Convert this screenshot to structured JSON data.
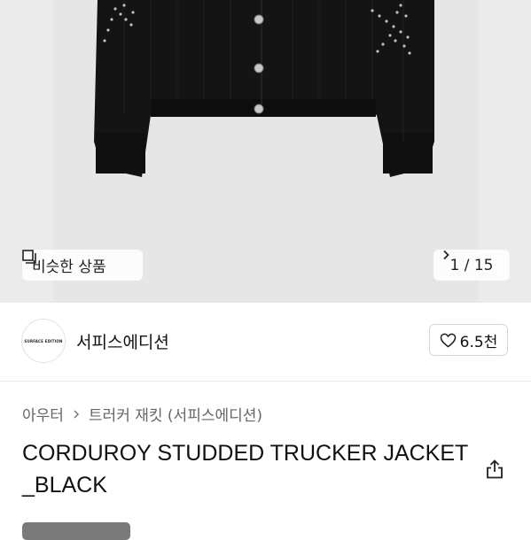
{
  "hero": {
    "image_alt": "black corduroy studded trucker jacket",
    "similar_label": "비슷한 상품",
    "image_counter": "1 / 15"
  },
  "brand": {
    "logo_text": "SURFACE EDITION",
    "name": "서피스에디션",
    "like_count": "6.5천"
  },
  "breadcrumb": {
    "category": "아우터",
    "subcategory": "트러커 재킷 (서피스에디션)"
  },
  "product": {
    "title": "CORDUROY STUDDED TRUCKER JACKET_BLACK"
  },
  "icons": [
    "similar-icon",
    "chevron-right-icon",
    "heart-icon",
    "share-icon"
  ],
  "colors": {
    "hero_bg": "#ebebeb",
    "jacket": "#141414",
    "text_muted": "#666666"
  }
}
